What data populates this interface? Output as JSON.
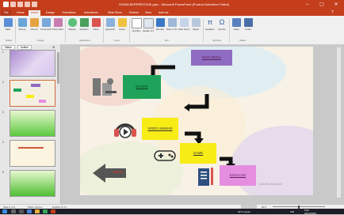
{
  "window": {
    "title": "SISWA BERPRESTASI.pptx - Microsoft PowerPoint (Product Activation Failed)",
    "minimize": "–",
    "maximize": "▢",
    "close": "✕"
  },
  "tabs": [
    "File",
    "Home",
    "Insert",
    "Design",
    "Transitions",
    "Animations",
    "Slide Show",
    "Review",
    "View",
    "Add-Ins"
  ],
  "ribbon": {
    "buttons": [
      "Table",
      "Picture",
      "Clip Art",
      "Screenshot",
      "Photo Album",
      "Shapes",
      "SmartArt",
      "Chart",
      "Hyperlink",
      "Action",
      "Text Box",
      "Header & Footer",
      "WordArt",
      "Date & Time",
      "Slide Number",
      "Object",
      "Equation",
      "Symbol",
      "Video",
      "Audio"
    ],
    "groups": [
      "Tables",
      "Images",
      "Illustrations",
      "Links",
      "Text",
      "Symbols",
      "Media"
    ]
  },
  "panel": {
    "tabs": [
      "Slides",
      "Outline"
    ],
    "slide_numbers": [
      "1",
      "2",
      "3",
      "4",
      "5"
    ]
  },
  "slide": {
    "boxes": {
      "menu": "MAIN MENU",
      "materi": "MATERI",
      "video": "VIDEO ANIMASI",
      "game": "GAME",
      "evaluasi": "EVALUASI",
      "back": "BACK"
    },
    "watermark": "Activate Windows"
  },
  "status": {
    "slide": "Slide 2 of 6",
    "theme": "\"Office Theme\"",
    "language": "English (U.S.)",
    "zoom": "66%"
  },
  "taskbar": {
    "weather": "32°C Cerah",
    "language": "IND",
    "time": "9:00",
    "date": "20/12/2023"
  },
  "colors": {
    "accent": "#c43e1c",
    "materi": "#1fa35a",
    "menu": "#8f6cc1",
    "video": "#f7ec16",
    "game": "#f7ec16",
    "evaluasi": "#e58ee0",
    "back": "#c7392f"
  }
}
